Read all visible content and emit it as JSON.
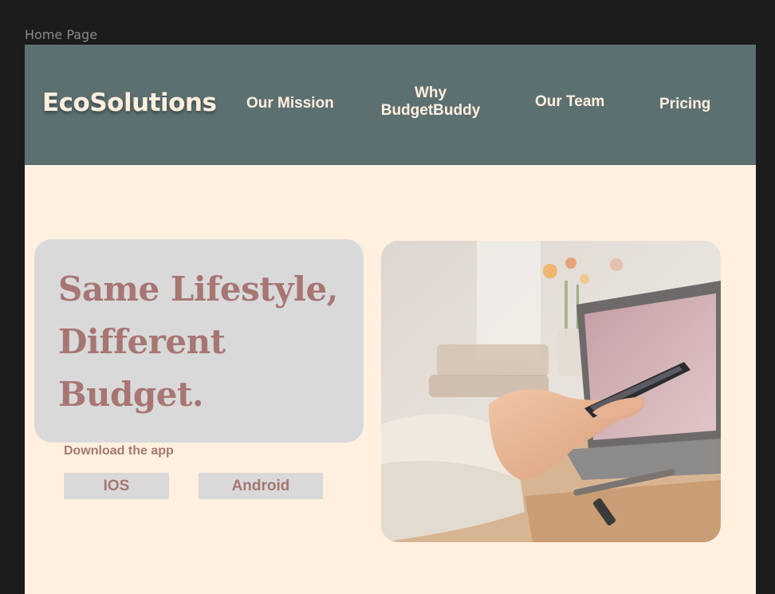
{
  "frame": {
    "label": "Home Page"
  },
  "navbar": {
    "logo": "EcoSolutions",
    "items": [
      {
        "label": "Our Mission"
      },
      {
        "label_line1": "Why",
        "label_line2": "BudgetBuddy"
      },
      {
        "label": "Our Team"
      },
      {
        "label": "Pricing"
      }
    ]
  },
  "hero": {
    "title_lines": [
      "Same Lifestyle,",
      "Different",
      "Budget."
    ],
    "download_label": "Download the app",
    "buttons": {
      "ios": "IOS",
      "android": "Android"
    }
  },
  "colors": {
    "page_background": "#1c1c1c",
    "frame_background": "#fff0e0",
    "navbar": "#5d7071",
    "nav_text": "#fff0e0",
    "card": "#d9d9d9",
    "accent_text": "#a77673"
  }
}
